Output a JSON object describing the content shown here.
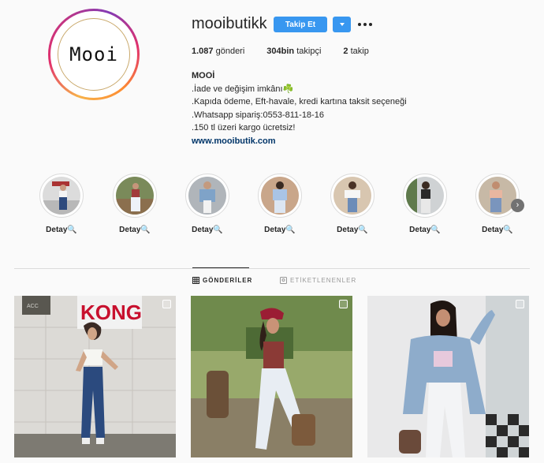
{
  "profile": {
    "username": "mooibutikk",
    "avatar_text": "Mooi",
    "follow_label": "Takip Et",
    "stats": {
      "posts_count": "1.087",
      "posts_label": "gönderi",
      "followers_count": "304bin",
      "followers_label": "takipçi",
      "following_count": "2",
      "following_label": "takip"
    },
    "bio": {
      "name": "MOOİ",
      "lines": [
        ".İade ve değişim imkânı☘️",
        ".Kapıda ödeme, Eft-havale, kredi kartına taksit seçeneği",
        ".Whatsapp sipariş:0553-811-18-16",
        ".150 tl üzeri kargo ücretsiz!"
      ],
      "link": "www.mooibutik.com"
    }
  },
  "highlights": [
    {
      "label": "Detay🔍"
    },
    {
      "label": "Detay🔍"
    },
    {
      "label": "Detay🔍"
    },
    {
      "label": "Detay🔍"
    },
    {
      "label": "Detay🔍"
    },
    {
      "label": "Detay🔍"
    },
    {
      "label": "Detay🔍"
    }
  ],
  "tabs": {
    "posts": "GÖNDERİLER",
    "tagged": "ETİKETLENENLER"
  },
  "posts": [
    {
      "sign_text": "KONG",
      "sign_small": "ACC"
    },
    {},
    {}
  ],
  "colors": {
    "accent": "#3897f0",
    "link": "#003569",
    "text": "#262626",
    "muted": "#999999",
    "border": "#dbdbdb"
  }
}
